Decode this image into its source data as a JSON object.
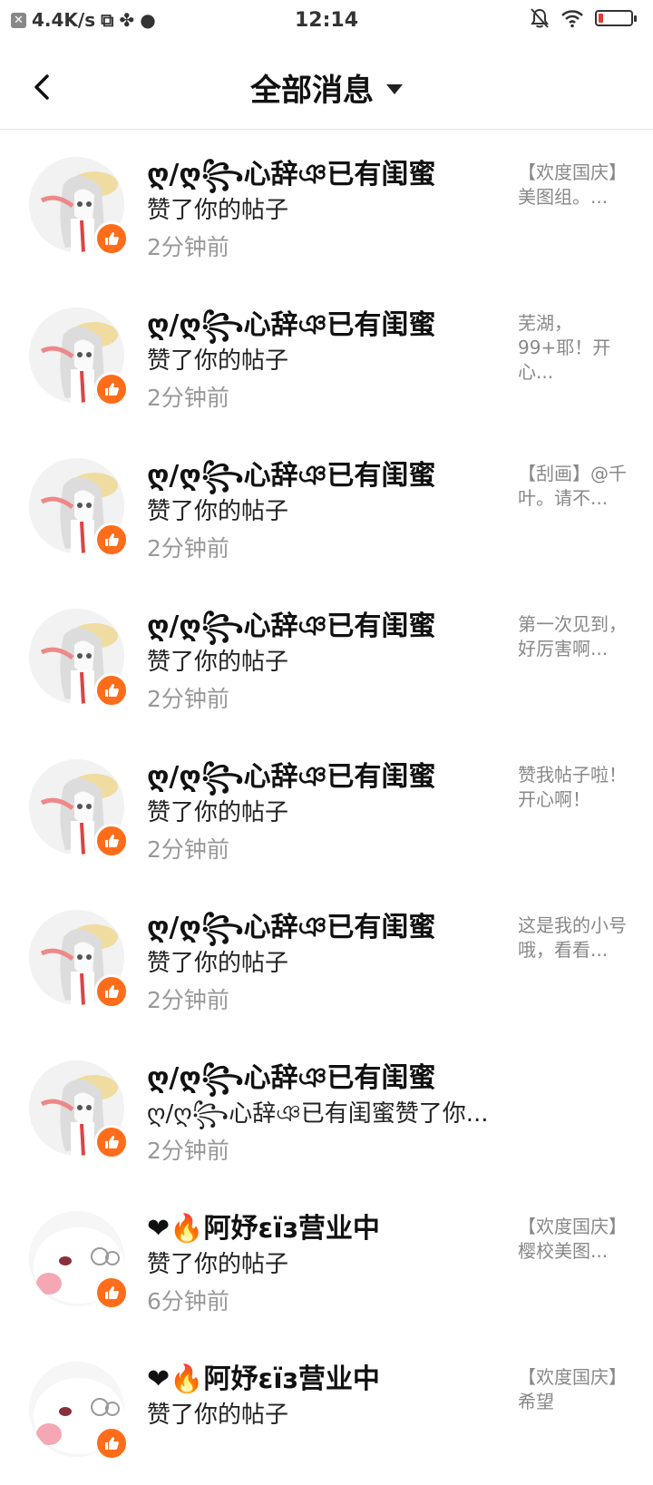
{
  "status_bar": {
    "speed": "4.4K/s",
    "time": "12:14",
    "battery_level": 0.15,
    "battery_color": "#e53935"
  },
  "nav": {
    "title": "全部消息",
    "back_icon": "chevron-left-icon",
    "dropdown_icon": "caret-down-icon"
  },
  "messages": [
    {
      "name": "ღ/ღ꧂心辞ঞ已有闺蜜",
      "action": "赞了你的帖子",
      "time": "2分钟前",
      "preview": "【欢度国庆】美图组。...",
      "avatar": "anime-girl"
    },
    {
      "name": "ღ/ღ꧂心辞ঞ已有闺蜜",
      "action": "赞了你的帖子",
      "time": "2分钟前",
      "preview": "芜湖，99+耶！开心...",
      "avatar": "anime-girl"
    },
    {
      "name": "ღ/ღ꧂心辞ঞ已有闺蜜",
      "action": "赞了你的帖子",
      "time": "2分钟前",
      "preview": "【刮画】@千叶。请不...",
      "avatar": "anime-girl"
    },
    {
      "name": "ღ/ღ꧂心辞ঞ已有闺蜜",
      "action": "赞了你的帖子",
      "time": "2分钟前",
      "preview": "第一次见到，好厉害啊...",
      "avatar": "anime-girl"
    },
    {
      "name": "ღ/ღ꧂心辞ঞ已有闺蜜",
      "action": "赞了你的帖子",
      "time": "2分钟前",
      "preview": "赞我帖子啦！开心啊！",
      "avatar": "anime-girl"
    },
    {
      "name": "ღ/ღ꧂心辞ঞ已有闺蜜",
      "action": "赞了你的帖子",
      "time": "2分钟前",
      "preview": "这是我的小号哦，看看...",
      "avatar": "anime-girl"
    },
    {
      "name": "ღ/ღ꧂心辞ঞ已有闺蜜",
      "action": "ღ/ღ꧂心辞ঞ已有闺蜜赞了你...",
      "time": "2分钟前",
      "preview": "",
      "avatar": "anime-girl"
    },
    {
      "name": "❤🔥阿妤εïз营业中",
      "action": "赞了你的帖子",
      "time": "6分钟前",
      "preview": "【欢度国庆】樱校美图...",
      "avatar": "white-face"
    },
    {
      "name": "❤🔥阿妤εïз营业中",
      "action": "赞了你的帖子",
      "time": "",
      "preview": "【欢度国庆】希望",
      "avatar": "white-face"
    }
  ],
  "colors": {
    "like_badge": "#ff6d1a",
    "muted_text": "#999999",
    "preview_text": "#888888"
  }
}
